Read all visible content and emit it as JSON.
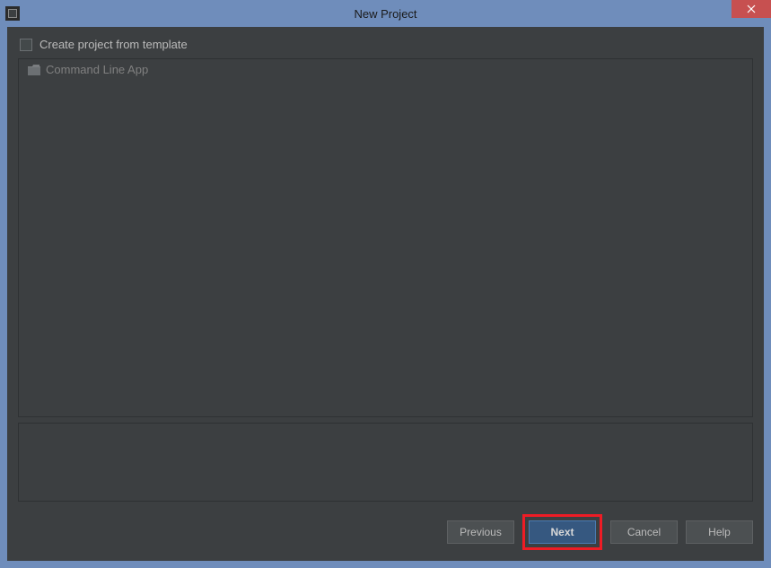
{
  "window": {
    "title": "New Project"
  },
  "checkbox": {
    "label": "Create project from template"
  },
  "templates": {
    "item0": {
      "label": "Command Line App"
    }
  },
  "buttons": {
    "previous": "Previous",
    "next": "Next",
    "cancel": "Cancel",
    "help": "Help"
  }
}
